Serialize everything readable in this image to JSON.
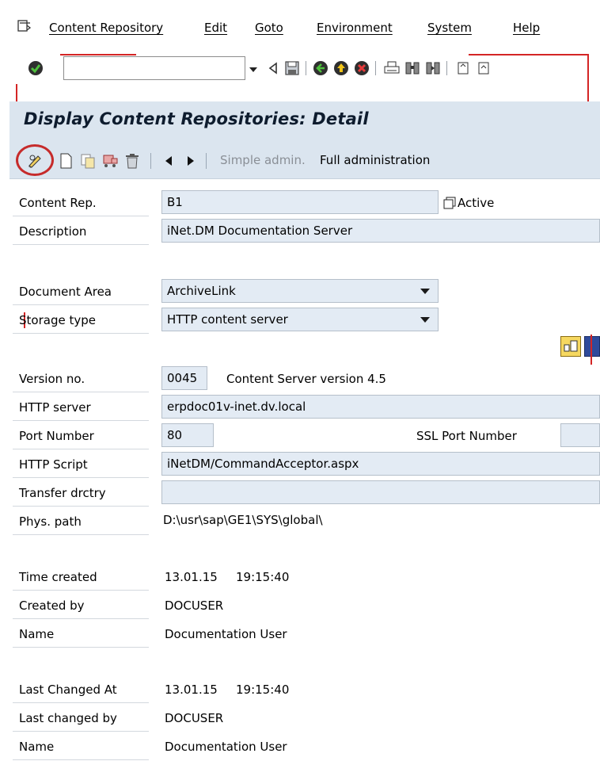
{
  "menu": {
    "items": [
      "Content Repository",
      "Edit",
      "Goto",
      "Environment",
      "System",
      "Help"
    ]
  },
  "toolbar": {
    "command_value": "",
    "icons": [
      "enter-icon",
      "back-icon",
      "save-icon",
      "green-back-icon",
      "exit-icon",
      "cancel-icon",
      "print-icon",
      "find-icon",
      "find-next-icon",
      "first-page-icon",
      "prev-page-icon"
    ]
  },
  "title": "Display Content Repositories: Detail",
  "app_toolbar": {
    "simple_admin": "Simple admin.",
    "full_admin": "Full administration"
  },
  "form": {
    "content_rep": {
      "label": "Content Rep.",
      "value": "B1",
      "status": "Active"
    },
    "description": {
      "label": "Description",
      "value": "iNet.DM Documentation Server"
    },
    "document_area": {
      "label": "Document Area",
      "value": "ArchiveLink"
    },
    "storage_type": {
      "label": "Storage type",
      "value": "HTTP content server"
    },
    "version_no": {
      "label": "Version no.",
      "value": "0045",
      "text": "Content Server version 4.5"
    },
    "http_server": {
      "label": "HTTP server",
      "value": "erpdoc01v-inet.dv.local"
    },
    "port_number": {
      "label": "Port Number",
      "value": "80",
      "ssl_label": "SSL Port Number",
      "ssl_value": ""
    },
    "http_script": {
      "label": "HTTP Script",
      "value": "iNetDM/CommandAcceptor.aspx"
    },
    "transfer_dir": {
      "label": "Transfer drctry",
      "value": ""
    },
    "phys_path": {
      "label": "Phys. path",
      "value": "D:\\usr\\sap\\GE1\\SYS\\global\\"
    },
    "time_created": {
      "label": "Time created",
      "date": "13.01.15",
      "time": "19:15:40"
    },
    "created_by": {
      "label": "Created by",
      "value": "DOCUSER"
    },
    "created_name": {
      "label": "Name",
      "value": "Documentation User"
    },
    "last_changed_at": {
      "label": "Last Changed At",
      "date": "13.01.15",
      "time": "19:15:40"
    },
    "last_changed_by": {
      "label": "Last changed by",
      "value": "DOCUSER"
    },
    "changed_name": {
      "label": "Name",
      "value": "Documentation User"
    }
  },
  "colors": {
    "header_bg": "#dbe5ef",
    "field_bg": "#e3ebf4",
    "annotation_red": "#c62b2b"
  }
}
